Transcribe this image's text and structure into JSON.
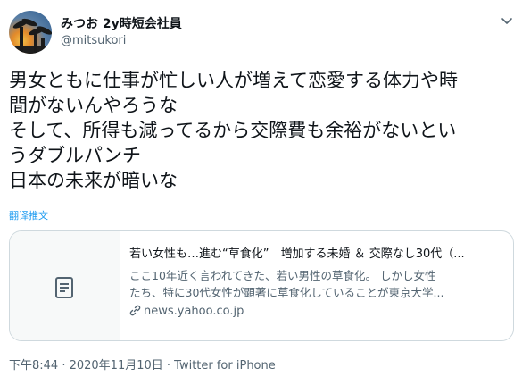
{
  "user": {
    "display_name": "みつお 2y時短会社員",
    "handle": "@mitsukori"
  },
  "tweet": {
    "lines": [
      "男女ともに仕事が忙しい人が増えて恋愛する体力や時",
      "間がないんやろうな",
      "そして、所得も減ってるから交際費も余裕がないとい",
      "うダブルパンチ",
      "日本の未来が暗いな"
    ],
    "translate_label": "翻译推文"
  },
  "card": {
    "thumbnail_icon": "document-icon",
    "title": "若い女性も…進む“草食化”　増加する未婚 ＆ 交際なし30代（...",
    "description_lines": [
      "ここ10年近く言われてきた、若い男性の草食化。 しかし女性",
      "たち、特に30代女性が顕著に草食化していることが東京大学..."
    ],
    "domain": "news.yahoo.co.jp"
  },
  "meta": {
    "timestamp": "下午8:44 · 2020年11月10日 · Twitter for iPhone"
  },
  "colors": {
    "link": "#1d9bf0",
    "secondary_text": "#536471",
    "border": "#cfd9de"
  }
}
